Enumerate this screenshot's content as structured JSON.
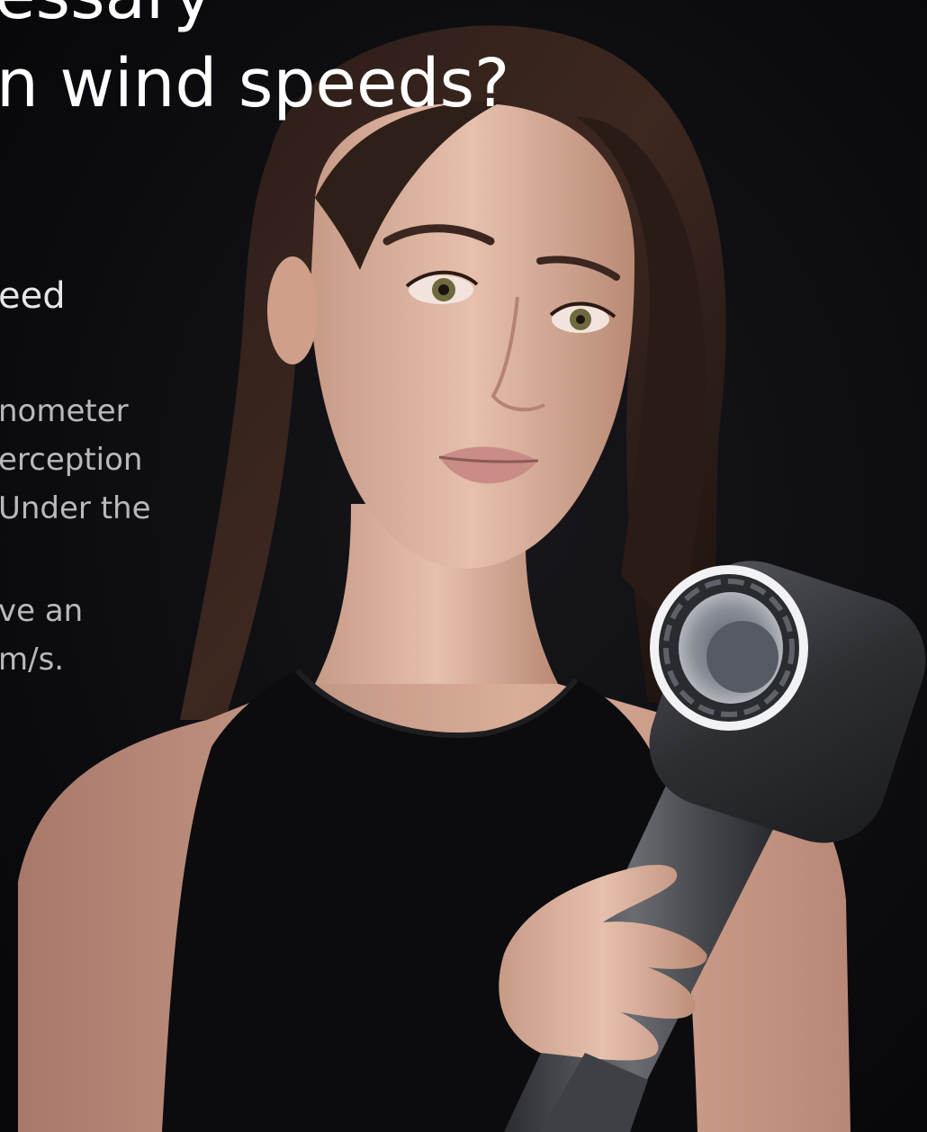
{
  "headline": {
    "line1": "essary",
    "line2": "n wind speeds?"
  },
  "subheading": "eed",
  "body_lines": [
    "nometer",
    "erception",
    "Under the",
    "ve an",
    "m/s."
  ],
  "colors": {
    "background": "#0b0a0e",
    "headline": "#ffffff",
    "body_text": "#b9b9bb",
    "dryer_body": "#3a3b3f",
    "dryer_ring": "#f2f2f4"
  }
}
